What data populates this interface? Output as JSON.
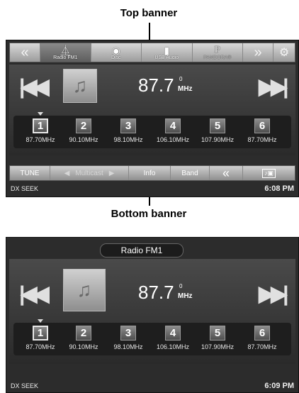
{
  "callouts": {
    "top": "Top banner",
    "bottom": "Bottom banner"
  },
  "top_banner": {
    "left_arrow": "«",
    "sources": [
      {
        "label": "Radio FM1",
        "icon": "antenna-icon"
      },
      {
        "label": "Disc",
        "icon": "disc-icon"
      },
      {
        "label": "USB Audio",
        "icon": "usb-icon"
      },
      {
        "label": "PANDORA®",
        "icon": "pandora-icon"
      }
    ],
    "right_arrow": "»",
    "setup_icon": "setup-icon"
  },
  "screen1": {
    "frequency": "87.7",
    "superscript": "0",
    "unit": "MHz",
    "presets": [
      {
        "num": "1",
        "freq": "87.70MHz"
      },
      {
        "num": "2",
        "freq": "90.10MHz"
      },
      {
        "num": "3",
        "freq": "98.10MHz"
      },
      {
        "num": "4",
        "freq": "106.10MHz"
      },
      {
        "num": "5",
        "freq": "107.90MHz"
      },
      {
        "num": "6",
        "freq": "87.70MHz"
      }
    ],
    "bottom_banner": {
      "tune": "TUNE",
      "multicast": "Multicast",
      "info": "Info",
      "band": "Band",
      "collapse": "«"
    },
    "status": {
      "mode": "DX SEEK",
      "time": "6:08 PM"
    }
  },
  "screen2": {
    "source_tab": "Radio FM1",
    "frequency": "87.7",
    "superscript": "0",
    "unit": "MHz",
    "presets": [
      {
        "num": "1",
        "freq": "87.70MHz"
      },
      {
        "num": "2",
        "freq": "90.10MHz"
      },
      {
        "num": "3",
        "freq": "98.10MHz"
      },
      {
        "num": "4",
        "freq": "106.10MHz"
      },
      {
        "num": "5",
        "freq": "107.90MHz"
      },
      {
        "num": "6",
        "freq": "87.70MHz"
      }
    ],
    "status": {
      "mode": "DX SEEK",
      "time": "6:09 PM"
    }
  }
}
